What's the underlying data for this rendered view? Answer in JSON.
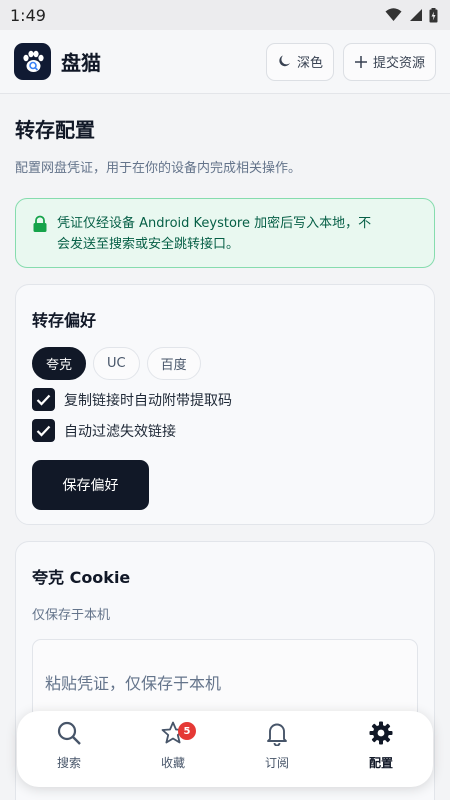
{
  "status_bar": {
    "time": "1:49"
  },
  "header": {
    "app_name": "盘猫",
    "theme_button": "深色",
    "submit_button": "提交资源"
  },
  "page": {
    "title": "转存配置",
    "subtitle": "配置网盘凭证，用于在你的设备内完成相关操作。"
  },
  "notice": {
    "line1": "凭证仅经设备 Android Keystore 加密后写入本地，不",
    "line2": "会发送至搜索或安全跳转接口。",
    "color": "#86dcae"
  },
  "preferences": {
    "title": "转存偏好",
    "chips": [
      {
        "label": "夸克",
        "selected": true
      },
      {
        "label": "UC",
        "selected": false
      },
      {
        "label": "百度",
        "selected": false
      }
    ],
    "options": [
      {
        "label": "复制链接时自动附带提取码",
        "checked": true
      },
      {
        "label": "自动过滤失效链接",
        "checked": true
      }
    ],
    "save_button": "保存偏好"
  },
  "cookie": {
    "title": "夸克 Cookie",
    "subtitle": "仅保存于本机",
    "input_placeholder": "粘贴凭证，仅保存于本机",
    "input_value": ""
  },
  "bottom_nav": {
    "items": [
      {
        "label": "搜索",
        "icon": "search-icon",
        "active": false
      },
      {
        "label": "收藏",
        "icon": "star-icon",
        "active": false,
        "badge": "5"
      },
      {
        "label": "订阅",
        "icon": "bell-icon",
        "active": false
      },
      {
        "label": "配置",
        "icon": "gear-icon",
        "active": true
      }
    ]
  },
  "colors": {
    "primary": "#111827",
    "badge": "#e53935",
    "notice_bg": "#e9f8f0"
  }
}
